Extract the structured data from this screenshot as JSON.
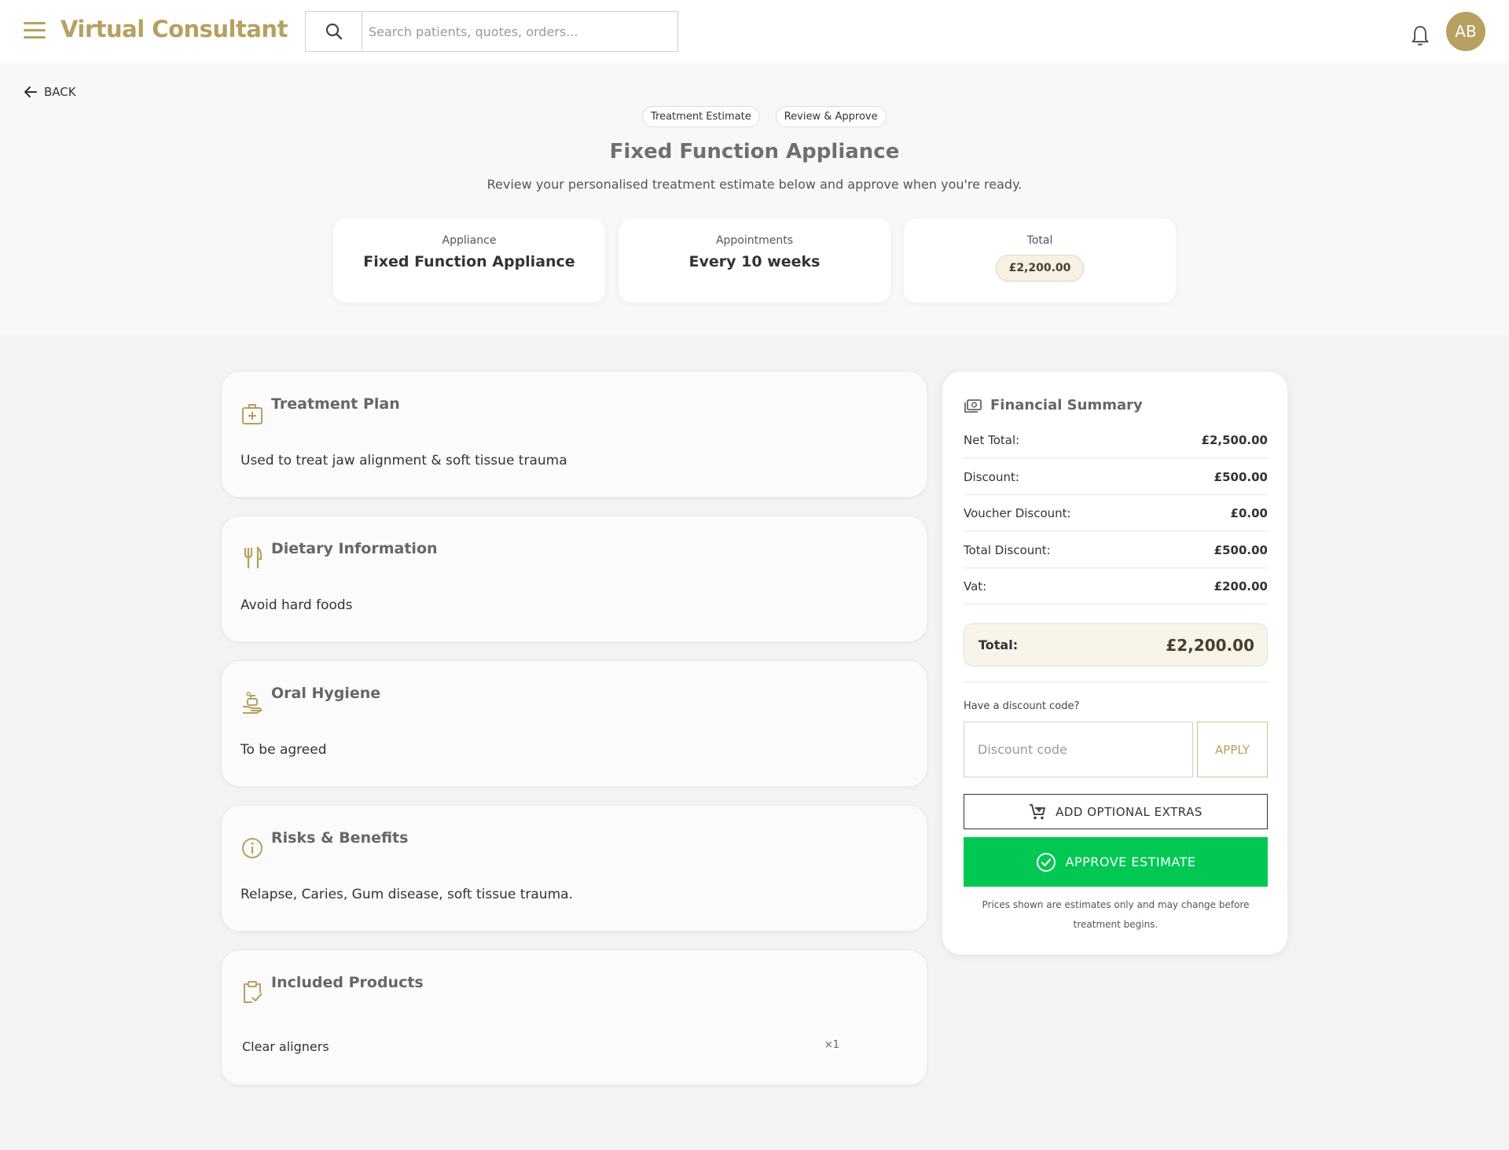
{
  "header": {
    "brand": "Virtual Consultant",
    "search_placeholder": "Search patients, quotes, orders...",
    "avatar_initials": "AB"
  },
  "nav": {
    "back_label": "BACK"
  },
  "hero": {
    "chips": [
      "Treatment Estimate",
      "Review & Approve"
    ],
    "title": "Fixed Function Appliance",
    "subtitle": "Review your personalised treatment estimate below and approve when you're ready."
  },
  "stats": {
    "appliance_label": "Appliance",
    "appliance_value": "Fixed Function Appliance",
    "appointments_label": "Appointments",
    "appointments_value": "Every 10 weeks",
    "total_label": "Total",
    "total_value": "£2,200.00"
  },
  "sections": [
    {
      "title": "Treatment Plan",
      "body": "Used to treat jaw alignment & soft tissue trauma",
      "icon": "medical-bag-icon"
    },
    {
      "title": "Dietary Information",
      "body": "Avoid hard foods",
      "icon": "utensils-icon"
    },
    {
      "title": "Oral Hygiene",
      "body": "To be agreed",
      "icon": "hand-wash-icon"
    },
    {
      "title": "Risks & Benefits",
      "body": "Relapse, Caries, Gum disease, soft tissue trauma.",
      "icon": "info-icon"
    },
    {
      "title": "Included Products",
      "icon": "clipboard-check-icon",
      "products": [
        {
          "name": "Clear aligners",
          "qty": "×1"
        }
      ]
    }
  ],
  "financial": {
    "title": "Financial Summary",
    "rows": [
      {
        "label": "Net Total:",
        "value": "£2,500.00"
      },
      {
        "label": "Discount:",
        "value": "£500.00"
      },
      {
        "label": "Voucher Discount:",
        "value": "£0.00"
      },
      {
        "label": "Total Discount:",
        "value": "£500.00"
      },
      {
        "label": "Vat:",
        "value": "£200.00"
      }
    ],
    "total_label": "Total:",
    "total_value": "£2,200.00",
    "discount_question": "Have a discount code?",
    "discount_placeholder": "Discount code",
    "apply_label": "APPLY",
    "extras_label": "ADD OPTIONAL EXTRAS",
    "approve_label": "APPROVE ESTIMATE",
    "note": "Prices shown are estimates only and may change before treatment begins."
  },
  "colors": {
    "brand_gold": "#b7a060",
    "approve_green": "#00c853"
  }
}
